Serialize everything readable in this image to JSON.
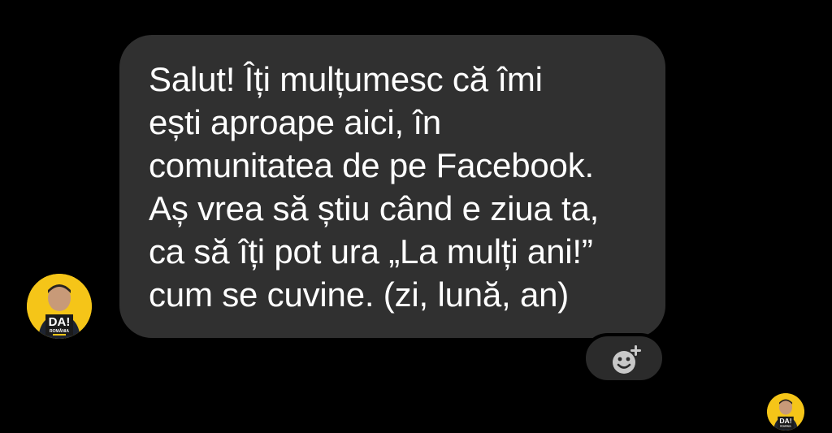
{
  "message": {
    "lines": [
      "Salut! Îți mulțumesc că îmi",
      "ești aproape aici, în",
      "comunitatea de pe Facebook.",
      "Aș vrea să știu când e ziua ta,",
      "ca să îți pot ura „La mulți ani!”",
      "cum se cuvine. (zi, lună, an)"
    ]
  },
  "avatar": {
    "badge_text": "DA!",
    "badge_subtext": "ROMÂNIA"
  },
  "react_button": {
    "icon": "add-reaction-icon"
  },
  "colors": {
    "background": "#000000",
    "bubble": "#303030",
    "text": "#ffffff",
    "avatar_brand": "#f5c518",
    "react_icon": "#c8c8c8"
  }
}
